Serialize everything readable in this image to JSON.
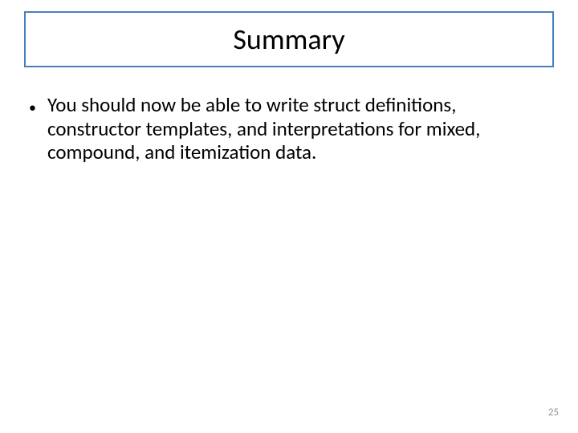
{
  "title": "Summary",
  "bullets": [
    "You should now be able to write struct definitions, constructor templates, and interpretations for mixed, compound, and itemization data."
  ],
  "page_number": "25"
}
